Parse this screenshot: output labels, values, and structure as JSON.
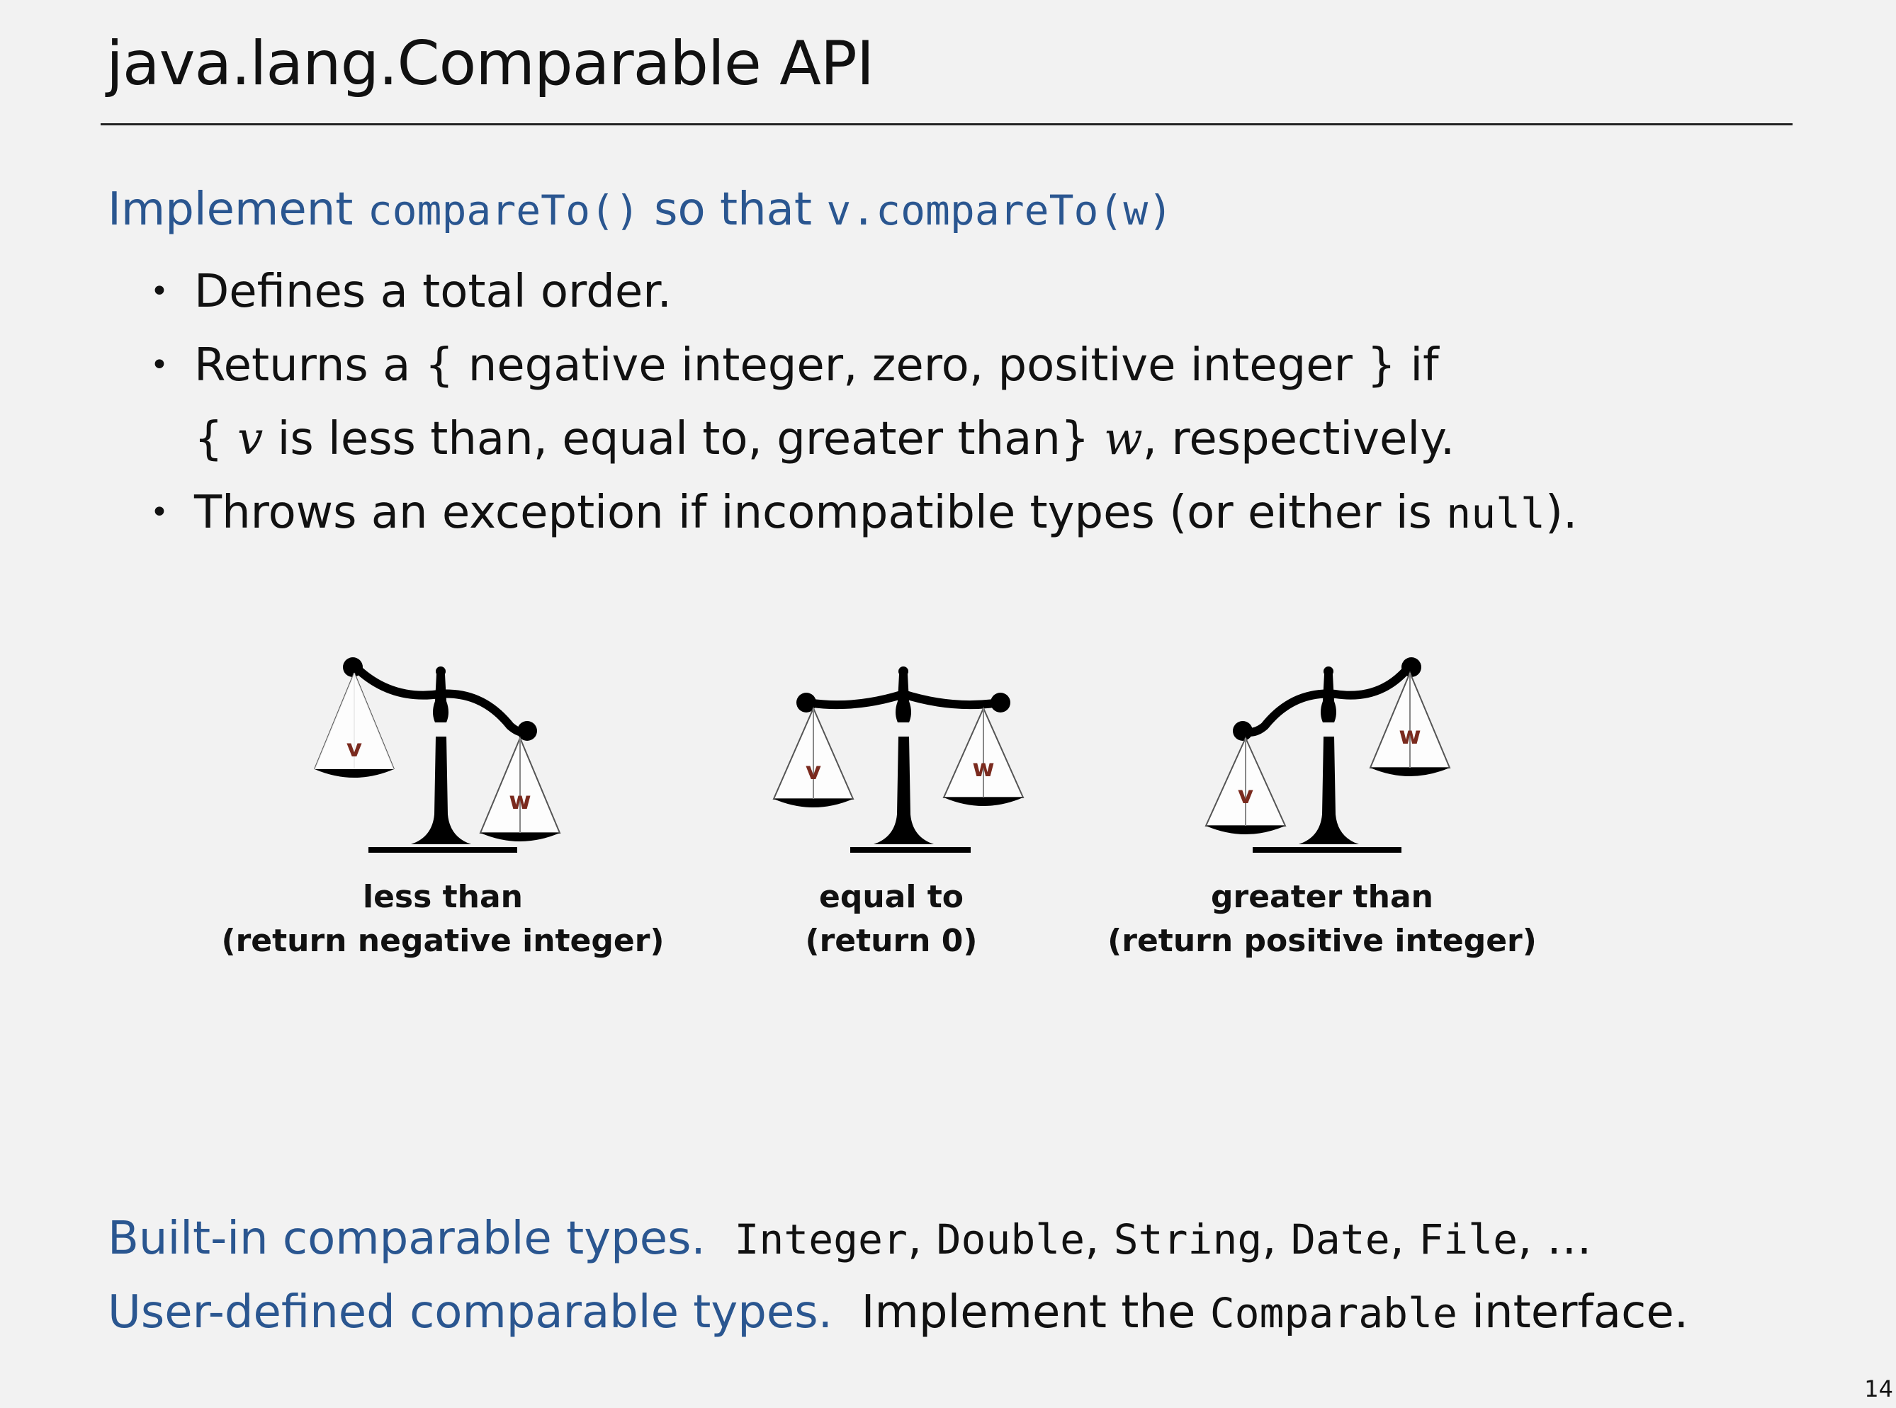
{
  "slide": {
    "title": "java.lang.Comparable API",
    "page_number": "14"
  },
  "intro": {
    "lead": "Implement ",
    "method": "compareTo()",
    "middle": " so that ",
    "call": "v.compareTo(w)"
  },
  "bullets": {
    "b1": "Defines a total order.",
    "b2_line1": "Returns a { negative integer, zero, positive integer } if",
    "b2_l2_a": "{ ",
    "b2_l2_v": "v",
    "b2_l2_b": " is less than, equal to, greater than} ",
    "b2_l2_w": "w",
    "b2_l2_c": ", respectively.",
    "b3_a": "Throws an exception if incompatible types (or either is ",
    "b3_null": "null",
    "b3_b": ")."
  },
  "scales": [
    {
      "pan_left": "v",
      "pan_right": "w",
      "caption1": "less than",
      "caption2": "(return negative integer)"
    },
    {
      "pan_left": "v",
      "pan_right": "w",
      "caption1": "equal to",
      "caption2": "(return 0)"
    },
    {
      "pan_left": "v",
      "pan_right": "w",
      "caption1": "greater than",
      "caption2": "(return positive integer)"
    }
  ],
  "footer": {
    "builtin_label": "Built-in comparable types.",
    "builtin_types": [
      {
        "name": "Integer",
        "sep": ", "
      },
      {
        "name": "Double",
        "sep": ", "
      },
      {
        "name": "String",
        "sep": ", "
      },
      {
        "name": "Date",
        "sep": ", "
      },
      {
        "name": "File",
        "sep": ", …"
      }
    ],
    "user_label": "User-defined comparable types.",
    "user_a": "Implement the ",
    "user_iface": "Comparable",
    "user_b": " interface."
  },
  "colors": {
    "accent_blue": "#2a5690",
    "pan_letter": "#7a2a1e",
    "background": "#f2f2f2"
  },
  "icons": [
    "balance-scale-icon"
  ]
}
